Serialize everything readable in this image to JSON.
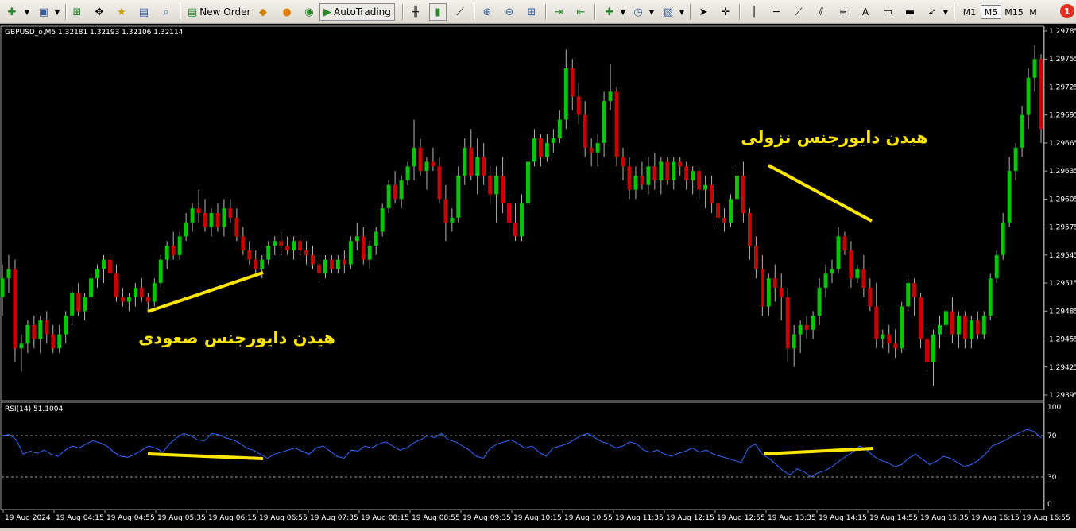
{
  "toolbar": {
    "new_order_label": "New Order",
    "autotrading_label": "AutoTrading",
    "timeframes": [
      {
        "label": "M1",
        "active": false
      },
      {
        "label": "M5",
        "active": true
      },
      {
        "label": "M15",
        "active": false
      },
      {
        "label": "M",
        "active": false
      }
    ],
    "text_tool_label": "A"
  },
  "chart": {
    "header": "GBPUSD_o,M5  1.32181 1.32193 1.32106 1.32114",
    "price_labels": [
      "1.29785",
      "1.29755",
      "1.29725",
      "1.29695",
      "1.29665",
      "1.29635",
      "1.29605",
      "1.29575",
      "1.29545",
      "1.29515",
      "1.29485",
      "1.29455",
      "1.29425",
      "1.29395"
    ],
    "time_labels": [
      "19 Aug 2024",
      "19 Aug 04:15",
      "19 Aug 04:55",
      "19 Aug 05:35",
      "19 Aug 06:15",
      "19 Aug 06:55",
      "19 Aug 07:35",
      "19 Aug 08:15",
      "19 Aug 08:55",
      "19 Aug 09:35",
      "19 Aug 10:15",
      "19 Aug 10:55",
      "19 Aug 11:35",
      "19 Aug 12:15",
      "19 Aug 12:55",
      "19 Aug 13:35",
      "19 Aug 14:15",
      "19 Aug 14:55",
      "19 Aug 15:35",
      "19 Aug 16:15",
      "19 Aug 16:55"
    ],
    "annotation_bullish": "هیدن دایورجنس صعودی",
    "annotation_bearish": "هیدن دایورجنس نزولی",
    "colors": {
      "background": "#000000",
      "bull_candle": "#00c800",
      "bear_candle": "#c80000",
      "wick": "#b4b4b4",
      "annotation": "#ffe600",
      "rsi_line": "#2f6bff",
      "axis_text": "#ffffff"
    }
  },
  "rsi": {
    "header": "RSI(14) 51.1004",
    "levels": [
      "100",
      "70",
      "30",
      "0"
    ]
  },
  "chart_data": {
    "type": "candlestick",
    "symbol": "GBPUSD_o",
    "timeframe": "M5",
    "ylim": [
      1.29395,
      1.2979
    ],
    "candles": [
      [
        1.295,
        1.29535,
        1.2948,
        1.2952
      ],
      [
        1.2952,
        1.29545,
        1.29505,
        1.2953
      ],
      [
        1.2953,
        1.2954,
        1.2943,
        1.29445
      ],
      [
        1.29445,
        1.2946,
        1.2942,
        1.2945
      ],
      [
        1.2945,
        1.29475,
        1.2944,
        1.2947
      ],
      [
        1.2947,
        1.2948,
        1.29445,
        1.29455
      ],
      [
        1.29455,
        1.2948,
        1.2944,
        1.29475
      ],
      [
        1.29475,
        1.29485,
        1.2945,
        1.2946
      ],
      [
        1.2946,
        1.2947,
        1.2944,
        1.29445
      ],
      [
        1.29445,
        1.2947,
        1.2944,
        1.2946
      ],
      [
        1.2946,
        1.29485,
        1.2945,
        1.2948
      ],
      [
        1.2948,
        1.2951,
        1.2947,
        1.29505
      ],
      [
        1.29505,
        1.29515,
        1.2948,
        1.29485
      ],
      [
        1.29485,
        1.29505,
        1.29475,
        1.295
      ],
      [
        1.295,
        1.29525,
        1.2949,
        1.2952
      ],
      [
        1.2952,
        1.29535,
        1.2951,
        1.2953
      ],
      [
        1.2953,
        1.29545,
        1.29515,
        1.2954
      ],
      [
        1.2954,
        1.29545,
        1.2952,
        1.29525
      ],
      [
        1.29525,
        1.29535,
        1.29495,
        1.295
      ],
      [
        1.295,
        1.2951,
        1.2949,
        1.29495
      ],
      [
        1.29495,
        1.29505,
        1.29485,
        1.295
      ],
      [
        1.295,
        1.29515,
        1.2949,
        1.2951
      ],
      [
        1.2951,
        1.2952,
        1.29495,
        1.295
      ],
      [
        1.295,
        1.29505,
        1.29485,
        1.29495
      ],
      [
        1.29495,
        1.2952,
        1.2949,
        1.29515
      ],
      [
        1.29515,
        1.29545,
        1.2951,
        1.2954
      ],
      [
        1.2954,
        1.2956,
        1.2953,
        1.29555
      ],
      [
        1.29555,
        1.2957,
        1.2954,
        1.29545
      ],
      [
        1.29545,
        1.2957,
        1.2954,
        1.29565
      ],
      [
        1.29565,
        1.2959,
        1.2956,
        1.2958
      ],
      [
        1.2958,
        1.296,
        1.2957,
        1.29595
      ],
      [
        1.29595,
        1.29615,
        1.2958,
        1.2959
      ],
      [
        1.2959,
        1.29605,
        1.2957,
        1.29575
      ],
      [
        1.29575,
        1.29595,
        1.29565,
        1.2959
      ],
      [
        1.2959,
        1.296,
        1.2957,
        1.29575
      ],
      [
        1.29575,
        1.29605,
        1.29565,
        1.29595
      ],
      [
        1.29595,
        1.29605,
        1.2958,
        1.29585
      ],
      [
        1.29585,
        1.29595,
        1.2956,
        1.29565
      ],
      [
        1.29565,
        1.29575,
        1.29545,
        1.2955
      ],
      [
        1.2955,
        1.2956,
        1.29535,
        1.2954
      ],
      [
        1.2954,
        1.2955,
        1.29525,
        1.2953
      ],
      [
        1.2953,
        1.29545,
        1.2952,
        1.2954
      ],
      [
        1.2954,
        1.2956,
        1.29535,
        1.29555
      ],
      [
        1.29555,
        1.29565,
        1.29545,
        1.2956
      ],
      [
        1.2956,
        1.2957,
        1.29545,
        1.29555
      ],
      [
        1.29555,
        1.29565,
        1.29545,
        1.2955
      ],
      [
        1.2955,
        1.29565,
        1.2954,
        1.2956
      ],
      [
        1.2956,
        1.29565,
        1.29545,
        1.2955
      ],
      [
        1.2955,
        1.2956,
        1.29535,
        1.29545
      ],
      [
        1.29545,
        1.29555,
        1.2953,
        1.29535
      ],
      [
        1.29535,
        1.29545,
        1.29515,
        1.29525
      ],
      [
        1.29525,
        1.29545,
        1.2952,
        1.2954
      ],
      [
        1.2954,
        1.29545,
        1.29525,
        1.2953
      ],
      [
        1.2953,
        1.29545,
        1.29525,
        1.2954
      ],
      [
        1.2954,
        1.2955,
        1.29525,
        1.29535
      ],
      [
        1.29535,
        1.29565,
        1.2953,
        1.2956
      ],
      [
        1.2956,
        1.2958,
        1.2955,
        1.29565
      ],
      [
        1.29565,
        1.29575,
        1.29535,
        1.2954
      ],
      [
        1.2954,
        1.2956,
        1.2953,
        1.29555
      ],
      [
        1.29555,
        1.29575,
        1.29545,
        1.2957
      ],
      [
        1.2957,
        1.296,
        1.29565,
        1.29595
      ],
      [
        1.29595,
        1.29625,
        1.2959,
        1.2962
      ],
      [
        1.2962,
        1.29635,
        1.296,
        1.29605
      ],
      [
        1.29605,
        1.2963,
        1.29595,
        1.29625
      ],
      [
        1.29625,
        1.29645,
        1.2962,
        1.2964
      ],
      [
        1.2964,
        1.2969,
        1.29625,
        1.2966
      ],
      [
        1.2966,
        1.2967,
        1.2963,
        1.29635
      ],
      [
        1.29635,
        1.2965,
        1.29615,
        1.29645
      ],
      [
        1.29645,
        1.2966,
        1.29635,
        1.2964
      ],
      [
        1.2964,
        1.2965,
        1.296,
        1.29605
      ],
      [
        1.29605,
        1.2962,
        1.2956,
        1.2958
      ],
      [
        1.2958,
        1.29595,
        1.2957,
        1.29585
      ],
      [
        1.29585,
        1.2964,
        1.2958,
        1.2963
      ],
      [
        1.2963,
        1.2967,
        1.2962,
        1.2966
      ],
      [
        1.2966,
        1.2968,
        1.29625,
        1.2963
      ],
      [
        1.2963,
        1.2967,
        1.2961,
        1.2965
      ],
      [
        1.2965,
        1.29665,
        1.2962,
        1.2963
      ],
      [
        1.2963,
        1.2964,
        1.296,
        1.2961
      ],
      [
        1.2961,
        1.2964,
        1.2958,
        1.2963
      ],
      [
        1.2963,
        1.2965,
        1.2959,
        1.296
      ],
      [
        1.296,
        1.2961,
        1.2957,
        1.2958
      ],
      [
        1.2958,
        1.296,
        1.2956,
        1.29565
      ],
      [
        1.29565,
        1.2961,
        1.2956,
        1.296
      ],
      [
        1.296,
        1.2965,
        1.29595,
        1.29645
      ],
      [
        1.29645,
        1.2968,
        1.2964,
        1.2967
      ],
      [
        1.2967,
        1.29675,
        1.2964,
        1.2965
      ],
      [
        1.2965,
        1.29675,
        1.29645,
        1.29665
      ],
      [
        1.29665,
        1.2968,
        1.29655,
        1.2967
      ],
      [
        1.2967,
        1.297,
        1.29665,
        1.2969
      ],
      [
        1.2969,
        1.29765,
        1.2968,
        1.29745
      ],
      [
        1.29745,
        1.29755,
        1.297,
        1.29715
      ],
      [
        1.29715,
        1.2973,
        1.29685,
        1.29695
      ],
      [
        1.29695,
        1.2971,
        1.2965,
        1.2966
      ],
      [
        1.2966,
        1.2967,
        1.2964,
        1.29655
      ],
      [
        1.29655,
        1.29675,
        1.2964,
        1.29665
      ],
      [
        1.29665,
        1.2972,
        1.2965,
        1.2971
      ],
      [
        1.2971,
        1.2975,
        1.297,
        1.2972
      ],
      [
        1.2972,
        1.29725,
        1.2964,
        1.2965
      ],
      [
        1.2965,
        1.2966,
        1.29625,
        1.2964
      ],
      [
        1.2964,
        1.2965,
        1.29605,
        1.29615
      ],
      [
        1.29615,
        1.2964,
        1.29605,
        1.2963
      ],
      [
        1.2963,
        1.29645,
        1.29615,
        1.2962
      ],
      [
        1.2962,
        1.2965,
        1.2961,
        1.2964
      ],
      [
        1.2964,
        1.29655,
        1.29615,
        1.29625
      ],
      [
        1.29625,
        1.2965,
        1.2961,
        1.29645
      ],
      [
        1.29645,
        1.2965,
        1.2962,
        1.29625
      ],
      [
        1.29625,
        1.2965,
        1.29615,
        1.29645
      ],
      [
        1.29645,
        1.2965,
        1.2963,
        1.2964
      ],
      [
        1.2964,
        1.29645,
        1.29615,
        1.29625
      ],
      [
        1.29625,
        1.2964,
        1.2961,
        1.29635
      ],
      [
        1.29635,
        1.2964,
        1.29605,
        1.29615
      ],
      [
        1.29615,
        1.2963,
        1.29595,
        1.2962
      ],
      [
        1.2962,
        1.2963,
        1.2959,
        1.296
      ],
      [
        1.296,
        1.2961,
        1.29575,
        1.29585
      ],
      [
        1.29585,
        1.29595,
        1.2957,
        1.2958
      ],
      [
        1.2958,
        1.2961,
        1.29575,
        1.29605
      ],
      [
        1.29605,
        1.2964,
        1.296,
        1.2963
      ],
      [
        1.2963,
        1.29645,
        1.2958,
        1.2959
      ],
      [
        1.2959,
        1.29595,
        1.2954,
        1.29555
      ],
      [
        1.29555,
        1.29565,
        1.2952,
        1.2953
      ],
      [
        1.2953,
        1.29545,
        1.2948,
        1.2949
      ],
      [
        1.2949,
        1.29525,
        1.2948,
        1.2952
      ],
      [
        1.2952,
        1.29535,
        1.29495,
        1.2951
      ],
      [
        1.2951,
        1.29525,
        1.29475,
        1.295
      ],
      [
        1.295,
        1.2951,
        1.2943,
        1.29445
      ],
      [
        1.29445,
        1.2947,
        1.29425,
        1.2946
      ],
      [
        1.2946,
        1.29475,
        1.2944,
        1.2947
      ],
      [
        1.2947,
        1.2948,
        1.29455,
        1.29465
      ],
      [
        1.29465,
        1.29485,
        1.29455,
        1.2948
      ],
      [
        1.2948,
        1.2952,
        1.2947,
        1.2951
      ],
      [
        1.2951,
        1.29535,
        1.295,
        1.29525
      ],
      [
        1.29525,
        1.2954,
        1.29515,
        1.2953
      ],
      [
        1.2953,
        1.29575,
        1.29525,
        1.29565
      ],
      [
        1.29565,
        1.2957,
        1.29545,
        1.2955
      ],
      [
        1.2955,
        1.2956,
        1.2951,
        1.2952
      ],
      [
        1.2952,
        1.29535,
        1.29515,
        1.2953
      ],
      [
        1.2953,
        1.29545,
        1.295,
        1.2951
      ],
      [
        1.2951,
        1.2952,
        1.29485,
        1.2949
      ],
      [
        1.2949,
        1.29515,
        1.29445,
        1.29455
      ],
      [
        1.29455,
        1.29465,
        1.29445,
        1.2946
      ],
      [
        1.2946,
        1.2947,
        1.2944,
        1.2945
      ],
      [
        1.2945,
        1.29465,
        1.29435,
        1.29445
      ],
      [
        1.29445,
        1.29495,
        1.2944,
        1.2949
      ],
      [
        1.2949,
        1.2952,
        1.29485,
        1.29515
      ],
      [
        1.29515,
        1.2952,
        1.2948,
        1.295
      ],
      [
        1.295,
        1.29505,
        1.29445,
        1.29455
      ],
      [
        1.29455,
        1.29465,
        1.2942,
        1.2943
      ],
      [
        1.2943,
        1.29465,
        1.29405,
        1.2946
      ],
      [
        1.2946,
        1.2948,
        1.29445,
        1.2947
      ],
      [
        1.2947,
        1.2949,
        1.2946,
        1.29485
      ],
      [
        1.29485,
        1.295,
        1.2945,
        1.2946
      ],
      [
        1.2946,
        1.29485,
        1.29445,
        1.2948
      ],
      [
        1.2948,
        1.29485,
        1.29445,
        1.29455
      ],
      [
        1.29455,
        1.2948,
        1.29445,
        1.29475
      ],
      [
        1.29475,
        1.29485,
        1.29455,
        1.2946
      ],
      [
        1.2946,
        1.29485,
        1.29455,
        1.2948
      ],
      [
        1.2948,
        1.29525,
        1.29475,
        1.2952
      ],
      [
        1.2952,
        1.2955,
        1.29515,
        1.29545
      ],
      [
        1.29545,
        1.2959,
        1.2954,
        1.2958
      ],
      [
        1.2958,
        1.2965,
        1.29575,
        1.29635
      ],
      [
        1.29635,
        1.29665,
        1.29625,
        1.2966
      ],
      [
        1.2966,
        1.29705,
        1.2965,
        1.29695
      ],
      [
        1.29695,
        1.29745,
        1.2968,
        1.29735
      ],
      [
        1.29735,
        1.2977,
        1.2972,
        1.29755
      ],
      [
        1.29755,
        1.2976,
        1.29665,
        1.2968
      ]
    ],
    "rsi": {
      "name": "RSI(14)",
      "last_value": 51.1004,
      "levels": [
        70,
        30
      ],
      "ylim": [
        0,
        100
      ],
      "values": [
        70,
        71,
        66,
        52,
        55,
        53,
        56,
        52,
        50,
        56,
        60,
        58,
        62,
        65,
        63,
        60,
        54,
        50,
        49,
        52,
        56,
        60,
        58,
        54,
        62,
        68,
        72,
        70,
        66,
        65,
        72,
        71,
        68,
        66,
        63,
        58,
        56,
        52,
        48,
        52,
        54,
        56,
        58,
        55,
        52,
        58,
        60,
        55,
        50,
        48,
        56,
        55,
        60,
        58,
        62,
        64,
        60,
        56,
        58,
        63,
        66,
        70,
        68,
        72,
        66,
        64,
        60,
        56,
        50,
        48,
        58,
        62,
        64,
        66,
        62,
        58,
        60,
        54,
        50,
        58,
        60,
        62,
        66,
        70,
        72,
        68,
        64,
        62,
        58,
        60,
        64,
        62,
        56,
        54,
        56,
        52,
        50,
        53,
        55,
        58,
        54,
        56,
        52,
        50,
        48,
        46,
        44,
        58,
        62,
        52,
        48,
        42,
        36,
        32,
        38,
        35,
        30,
        34,
        36,
        40,
        45,
        50,
        54,
        60,
        56,
        50,
        46,
        44,
        40,
        42,
        48,
        52,
        47,
        42,
        45,
        50,
        48,
        44,
        40,
        42,
        46,
        52,
        60,
        63,
        66,
        70,
        73,
        76,
        74,
        68
      ]
    }
  }
}
